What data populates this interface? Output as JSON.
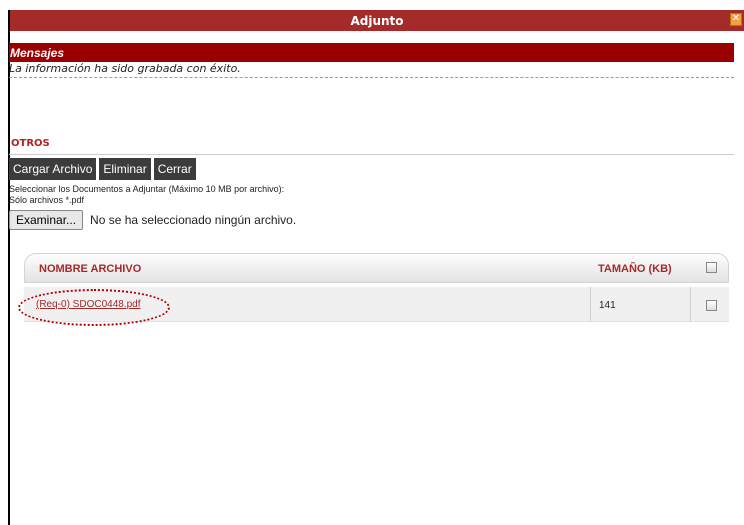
{
  "window": {
    "title": "Adjunto",
    "close_label": "✕"
  },
  "messages": {
    "header": "Mensajes",
    "text": "La información ha sido grabada con éxito."
  },
  "section": {
    "title": "OTROS"
  },
  "toolbar": {
    "upload_label": "Cargar Archivo",
    "delete_label": "Eliminar",
    "close_label": "Cerrar"
  },
  "instructions": {
    "line1": "Seleccionar los Documentos a Adjuntar (Máximo 10 MB por archivo):",
    "line2": "Sólo archivos *.pdf"
  },
  "file_input": {
    "button_label": "Examinar...",
    "status": "No se ha seleccionado ningún archivo."
  },
  "table": {
    "columns": [
      "NOMBRE ARCHIVO",
      "TAMAÑO (KB)"
    ],
    "rows": [
      {
        "name": "(Req-0) SDOC0448.pdf",
        "size": "141"
      }
    ]
  },
  "colors": {
    "titlebar": "#a52a2a",
    "messages_header": "#9b0000",
    "accent_text": "#a52a2a",
    "button_bg": "#3c3c3c"
  }
}
